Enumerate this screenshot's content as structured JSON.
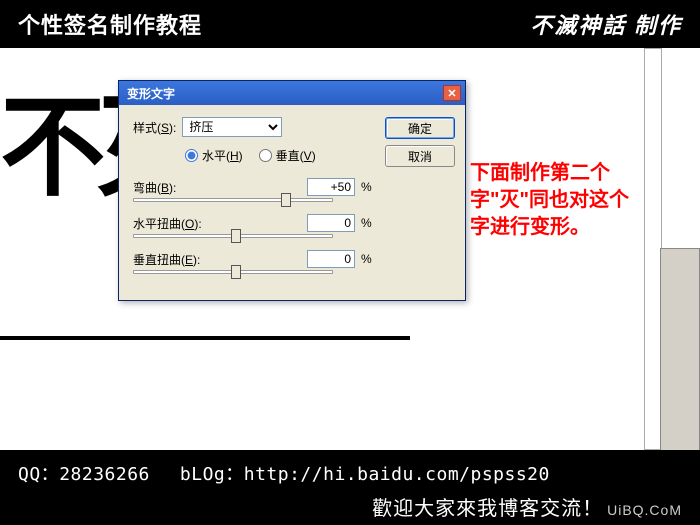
{
  "header": {
    "title": "个性签名制作教程",
    "brand": "不滅神話 制作"
  },
  "canvas_text": "不灭",
  "dialog": {
    "title": "变形文字",
    "style_label": "样式(",
    "style_key": "S",
    "style_label_end": "):",
    "style_value": "挤压",
    "orientation": {
      "horizontal": "水平(",
      "horizontal_key": "H",
      "horizontal_end": ")",
      "vertical": "垂直(",
      "vertical_key": "V",
      "vertical_end": ")",
      "selected": "horizontal"
    },
    "bend": {
      "label": "弯曲(",
      "key": "B",
      "label_end": "):",
      "value": "+50",
      "unit": "%"
    },
    "hdist": {
      "label": "水平扭曲(",
      "key": "O",
      "label_end": "):",
      "value": "0",
      "unit": "%"
    },
    "vdist": {
      "label": "垂直扭曲(",
      "key": "E",
      "label_end": "):",
      "value": "0",
      "unit": "%"
    },
    "ok": "确定",
    "cancel": "取消"
  },
  "annotation": "下面制作第二个字\"灭\"同也对这个字进行变形。",
  "footer": {
    "qq_label": "QQ：",
    "qq_value": "28236266",
    "blog_label": "bLOg：",
    "blog_value": "http://hi.baidu.com/pspss20",
    "line2": "歡迎大家來我博客交流！",
    "site": "UiBQ.CoM"
  }
}
